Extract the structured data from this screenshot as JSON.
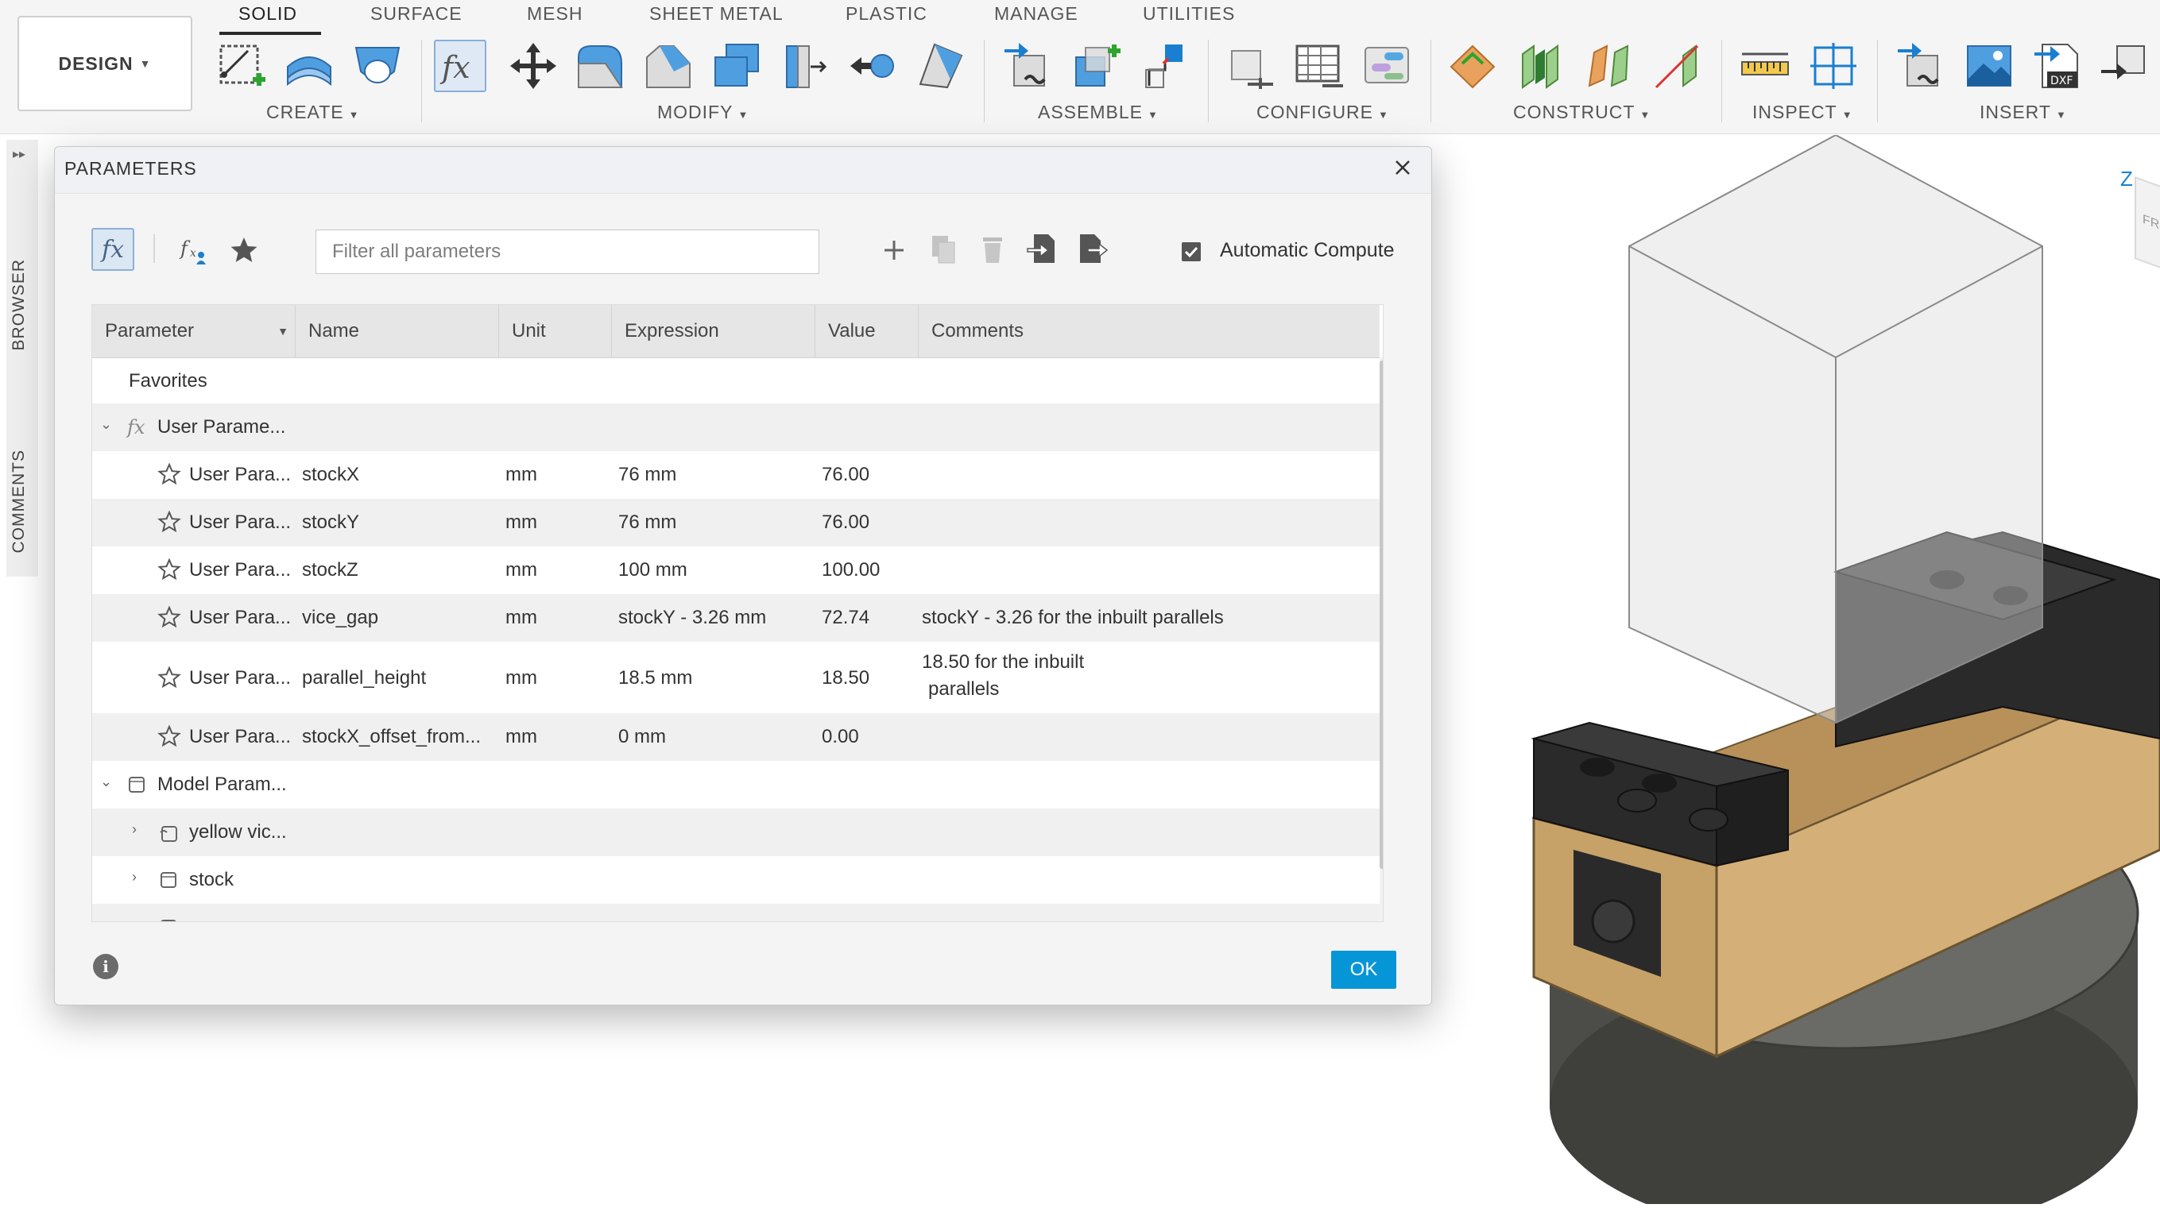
{
  "workspace": {
    "label": "DESIGN"
  },
  "tabs": [
    {
      "label": "SOLID",
      "active": true
    },
    {
      "label": "SURFACE"
    },
    {
      "label": "MESH"
    },
    {
      "label": "SHEET METAL"
    },
    {
      "label": "PLASTIC"
    },
    {
      "label": "MANAGE"
    },
    {
      "label": "UTILITIES"
    }
  ],
  "groups": [
    {
      "label": "CREATE"
    },
    {
      "label": "MODIFY"
    },
    {
      "label": "ASSEMBLE"
    },
    {
      "label": "CONFIGURE"
    },
    {
      "label": "CONSTRUCT"
    },
    {
      "label": "INSPECT"
    },
    {
      "label": "INSERT"
    }
  ],
  "side_panels": {
    "browser": "BROWSER",
    "comments": "COMMENTS"
  },
  "dialog": {
    "title": "PARAMETERS",
    "search_placeholder": "Filter all parameters",
    "auto_compute_label": "Automatic Compute",
    "auto_compute_checked": true,
    "ok_label": "OK",
    "columns": [
      "Parameter",
      "Name",
      "Unit",
      "Expression",
      "Value",
      "Comments"
    ],
    "favorites_label": "Favorites",
    "user_group_label": "User Parame...",
    "user_params": [
      {
        "parameter": "User Para...",
        "name": "stockX",
        "unit": "mm",
        "expression": "76 mm",
        "value": "76.00",
        "comment": ""
      },
      {
        "parameter": "User Para...",
        "name": "stockY",
        "unit": "mm",
        "expression": "76 mm",
        "value": "76.00",
        "comment": ""
      },
      {
        "parameter": "User Para...",
        "name": "stockZ",
        "unit": "mm",
        "expression": "100 mm",
        "value": "100.00",
        "comment": ""
      },
      {
        "parameter": "User Para...",
        "name": "vice_gap",
        "unit": "mm",
        "expression": "stockY - 3.26 mm",
        "value": "72.74",
        "comment": "stockY - 3.26 for the inbuilt parallels"
      },
      {
        "parameter": "User Para...",
        "name": "parallel_height",
        "unit": "mm",
        "expression": "18.5 mm",
        "value": "18.50",
        "comment_line1": "18.50 for the inbuilt",
        "comment_line2": "parallels"
      },
      {
        "parameter": "User Para...",
        "name": "stockX_offset_from...",
        "unit": "mm",
        "expression": "0 mm",
        "value": "0.00",
        "comment": ""
      }
    ],
    "model_group_label": "Model Param...",
    "model_children": [
      {
        "label": "yellow vic..."
      },
      {
        "label": "stock"
      }
    ]
  },
  "viewcube": {
    "axis_label": "Z",
    "face_label": "FRO"
  },
  "colors": {
    "accent": "#0696d7",
    "selected_bg": "#dbe7f3",
    "bronze": "#c7a268",
    "vise_black": "#2a2a2a",
    "base_gray": "#5a5a56"
  }
}
